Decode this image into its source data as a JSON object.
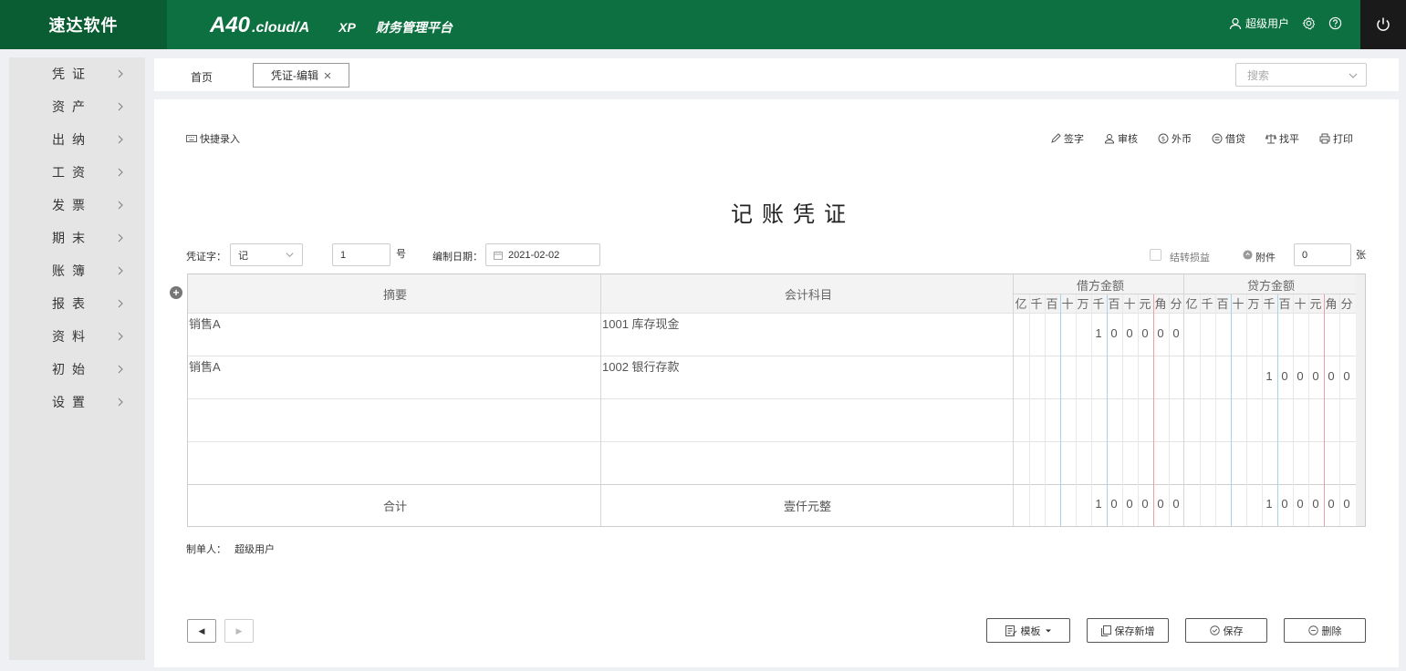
{
  "app": {
    "brand": "速达软件",
    "product_main": "A40",
    "product_sub": ".cloud/A",
    "edition": "XP",
    "platform": "财务管理平台",
    "user": "超级用户",
    "accent_color": "#0d7040"
  },
  "sidebar": {
    "items": [
      {
        "label": "凭证"
      },
      {
        "label": "资产"
      },
      {
        "label": "出纳"
      },
      {
        "label": "工资"
      },
      {
        "label": "发票"
      },
      {
        "label": "期末"
      },
      {
        "label": "账簿"
      },
      {
        "label": "报表"
      },
      {
        "label": "资料"
      },
      {
        "label": "初始"
      },
      {
        "label": "设置"
      }
    ]
  },
  "tabs": {
    "home": "首页",
    "active": "凭证-编辑",
    "search_placeholder": "搜索"
  },
  "toolbar": {
    "quick_entry": "快捷录入",
    "sign": "签字",
    "audit": "审核",
    "foreign_currency": "外币",
    "debit_credit": "借贷",
    "balance": "找平",
    "print": "打印"
  },
  "voucher": {
    "title": "记账凭证",
    "type_label": "凭证字：",
    "type_value": "记",
    "number": "1",
    "number_suffix": "号",
    "date_label": "编制日期：",
    "date_value": "2021-02-02",
    "carry_forward_label": "结转损益",
    "attachment_label": "附件",
    "attachment_count": "0",
    "attachment_suffix": "张",
    "maker_label": "制单人：",
    "maker_value": "超级用户"
  },
  "table": {
    "col_summary": "摘要",
    "col_account": "会计科目",
    "col_debit": "借方金额",
    "col_credit": "贷方金额",
    "digit_units": [
      "亿",
      "千",
      "百",
      "十",
      "万",
      "千",
      "百",
      "十",
      "元",
      "角",
      "分"
    ],
    "rows": [
      {
        "summary": "销售A",
        "account": "1001 库存现金",
        "debit": "100000",
        "credit": ""
      },
      {
        "summary": "销售A",
        "account": "1002 银行存款",
        "debit": "",
        "credit": "100000"
      },
      {
        "summary": "",
        "account": "",
        "debit": "",
        "credit": ""
      },
      {
        "summary": "",
        "account": "",
        "debit": "",
        "credit": ""
      }
    ],
    "total_label": "合计",
    "total_words": "壹仟元整",
    "total_debit": "100000",
    "total_credit": "100000"
  },
  "buttons": {
    "template": "模板",
    "save_new": "保存新增",
    "save": "保存",
    "delete": "删除",
    "prev": "◀",
    "next": "▶"
  }
}
